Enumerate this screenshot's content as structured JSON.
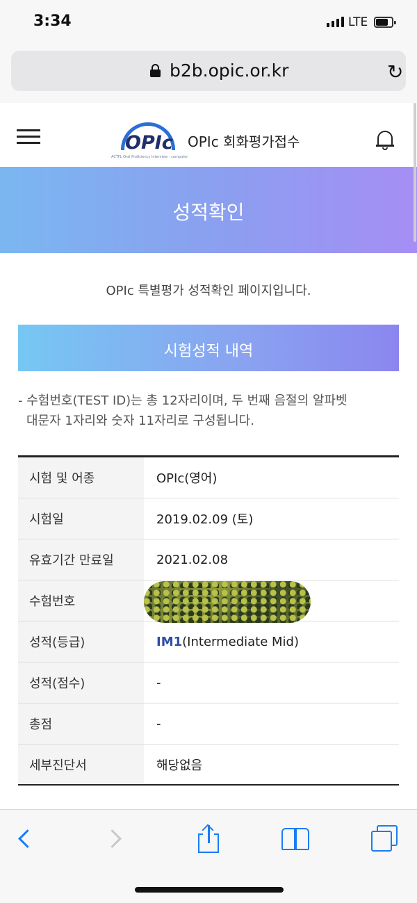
{
  "status_bar": {
    "time": "3:34",
    "network": "LTE"
  },
  "browser": {
    "url": "b2b.opic.or.kr"
  },
  "header": {
    "logo_text": "OPIc",
    "logo_tagline": "ACTFL Oral Proficiency Interview - computer",
    "title": "OPIc 회화평가접수"
  },
  "banner": {
    "title": "성적확인"
  },
  "intro": "OPIc 특별평가 성적확인 페이지입니다.",
  "section": {
    "title": "시험성적 내역"
  },
  "note": {
    "line1": "- 수험번호(TEST ID)는 총 12자리이며, 두 번째 음절의 알파벳",
    "line2": "대문자 1자리와 숫자 11자리로 구성됩니다."
  },
  "results": {
    "rows": [
      {
        "label": "시험 및 어종",
        "value": "OPIc(영어)"
      },
      {
        "label": "시험일",
        "value": "2019.02.09 (토)"
      },
      {
        "label": "유효기간 만료일",
        "value": "2021.02.08"
      },
      {
        "label": "수험번호",
        "value": ""
      },
      {
        "label": "성적(등급)",
        "grade": "IM1",
        "grade_detail": "(Intermediate Mid)"
      },
      {
        "label": "성적(점수)",
        "value": "-"
      },
      {
        "label": "총점",
        "value": "-"
      },
      {
        "label": "세부진단서",
        "value": "해당없음"
      }
    ]
  },
  "colors": {
    "accent": "#1a7cf4",
    "grade": "#2d4ca8",
    "banner_start": "#7ab7f1",
    "banner_end": "#a68ef4"
  },
  "toolbar": {
    "icons": [
      "back-icon",
      "forward-icon",
      "share-icon",
      "bookmarks-icon",
      "tabs-icon"
    ]
  }
}
